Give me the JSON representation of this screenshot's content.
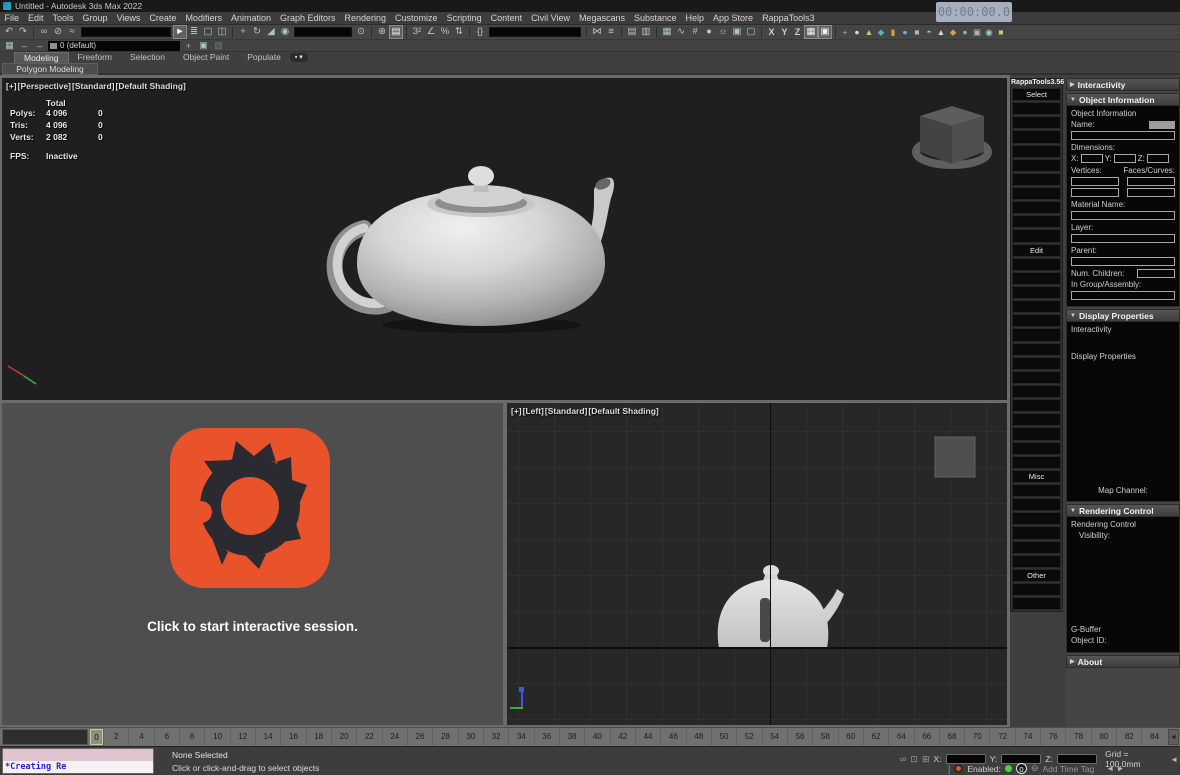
{
  "colors": {
    "corona_orange": "#e9532c",
    "logo_dark": "#2b2a30",
    "status_green": "#4ad04a"
  },
  "titlebar": {
    "title": "Untitled - Autodesk 3ds Max 2022"
  },
  "timecode": "00:00:00.0",
  "menus": [
    "File",
    "Edit",
    "Tools",
    "Group",
    "Views",
    "Create",
    "Modifiers",
    "Animation",
    "Graph Editors",
    "Rendering",
    "Customize",
    "Scripting",
    "Content",
    "Civil View",
    "Megascans",
    "Substance",
    "Help",
    "App Store",
    "RappaTools3"
  ],
  "toolbar_main": [
    {
      "n": "undo-icon",
      "g": "↶",
      "cls": "tbit i",
      "ia": "true"
    },
    {
      "n": "redo-icon",
      "g": "↷",
      "cls": "tbit i",
      "ia": "true"
    },
    {
      "n": "separator",
      "g": "",
      "cls": "tbit s",
      "ia": "false"
    },
    {
      "n": "select-and-link-icon",
      "g": "∞",
      "cls": "tbit i",
      "ia": "true"
    },
    {
      "n": "unlink-selection-icon",
      "g": "⊘",
      "cls": "tbit i",
      "ia": "true"
    },
    {
      "n": "bind-to-space-warp-icon",
      "g": "≈",
      "cls": "tbit i",
      "ia": "true"
    },
    {
      "n": "selection-filter-dropdown",
      "g": "",
      "cls": "tbit f",
      "style": "width:90px",
      "ia": "true"
    },
    {
      "n": "select-object-icon",
      "g": "►",
      "cls": "tbit i on",
      "ia": "true"
    },
    {
      "n": "select-by-name-icon",
      "g": "≣",
      "cls": "tbit i",
      "ia": "true"
    },
    {
      "n": "selection-region-icon",
      "g": "▢",
      "cls": "tbit i",
      "ia": "true"
    },
    {
      "n": "window-crossing-icon",
      "g": "◫",
      "cls": "tbit i",
      "ia": "true"
    },
    {
      "n": "separator",
      "g": "",
      "cls": "tbit s",
      "ia": "false"
    },
    {
      "n": "select-and-move-icon",
      "g": "+",
      "cls": "tbit i",
      "ia": "true"
    },
    {
      "n": "select-and-rotate-icon",
      "g": "↻",
      "cls": "tbit i",
      "ia": "true"
    },
    {
      "n": "select-and-scale-icon",
      "g": "◢",
      "cls": "tbit i",
      "ia": "true"
    },
    {
      "n": "select-and-place-icon",
      "g": "◉",
      "cls": "tbit i",
      "ia": "true"
    },
    {
      "n": "reference-coordinate-dropdown",
      "g": "",
      "cls": "tbit f",
      "style": "width:58px",
      "ia": "true"
    },
    {
      "n": "use-pivot-point-icon",
      "g": "⊙",
      "cls": "tbit i",
      "ia": "true"
    },
    {
      "n": "separator",
      "g": "",
      "cls": "tbit s",
      "ia": "false"
    },
    {
      "n": "select-and-manipulate-icon",
      "g": "⊕",
      "cls": "tbit i",
      "ia": "true"
    },
    {
      "n": "keyboard-shortcut-override-icon",
      "g": "▤",
      "cls": "tbit i on",
      "ia": "true"
    },
    {
      "n": "separator",
      "g": "",
      "cls": "tbit s",
      "ia": "false"
    },
    {
      "n": "snaps-toggle-icon",
      "g": "3²",
      "cls": "tbit i",
      "ia": "true"
    },
    {
      "n": "angle-snap-icon",
      "g": "∠",
      "cls": "tbit i",
      "ia": "true"
    },
    {
      "n": "percent-snap-icon",
      "g": "%",
      "cls": "tbit i",
      "ia": "true"
    },
    {
      "n": "spinner-snap-icon",
      "g": "⇅",
      "cls": "tbit i",
      "ia": "true"
    },
    {
      "n": "separator",
      "g": "",
      "cls": "tbit s",
      "ia": "false"
    },
    {
      "n": "edit-named-selection-sets-icon",
      "g": "{}",
      "cls": "tbit i",
      "ia": "true"
    },
    {
      "n": "named-selection-sets-dropdown",
      "g": "",
      "cls": "tbit f",
      "style": "width:92px",
      "ia": "true"
    },
    {
      "n": "separator",
      "g": "",
      "cls": "tbit s",
      "ia": "false"
    },
    {
      "n": "mirror-icon",
      "g": "⋈",
      "cls": "tbit i",
      "ia": "true"
    },
    {
      "n": "align-icon",
      "g": "≡",
      "cls": "tbit i",
      "ia": "true"
    },
    {
      "n": "separator",
      "g": "",
      "cls": "tbit s",
      "ia": "false"
    },
    {
      "n": "toggle-scene-explorer-icon",
      "g": "▤",
      "cls": "tbit i",
      "ia": "true"
    },
    {
      "n": "toggle-layer-explorer-icon",
      "g": "▥",
      "cls": "tbit i",
      "ia": "true"
    },
    {
      "n": "separator",
      "g": "",
      "cls": "tbit s",
      "ia": "false"
    },
    {
      "n": "toggle-ribbon-icon",
      "g": "▦",
      "cls": "tbit i",
      "ia": "true"
    },
    {
      "n": "curve-editor-icon",
      "g": "∿",
      "cls": "tbit i",
      "ia": "true"
    },
    {
      "n": "schematic-view-icon",
      "g": "#",
      "cls": "tbit i",
      "ia": "true"
    },
    {
      "n": "material-editor-icon",
      "g": "●",
      "cls": "tbit i",
      "ia": "true"
    },
    {
      "n": "render-setup-icon",
      "g": "☼",
      "cls": "tbit i",
      "ia": "true"
    },
    {
      "n": "rendered-frame-window-icon",
      "g": "▣",
      "cls": "tbit i",
      "ia": "true"
    },
    {
      "n": "render-production-icon",
      "g": "▢",
      "cls": "tbit i",
      "ia": "true"
    },
    {
      "n": "separator",
      "g": "",
      "cls": "tbit s",
      "ia": "false"
    },
    {
      "n": "x-constraint-button",
      "g": "X",
      "cls": "tbit t",
      "ia": "true"
    },
    {
      "n": "y-constraint-button",
      "g": "Y",
      "cls": "tbit t",
      "ia": "true"
    },
    {
      "n": "z-constraint-button",
      "g": "Z",
      "cls": "tbit t",
      "ia": "true"
    },
    {
      "n": "constraint-plane-icon",
      "g": "▦",
      "cls": "tbit i on",
      "ia": "true"
    },
    {
      "n": "constraint-plane-alt-icon",
      "g": "▣",
      "cls": "tbit i on",
      "ia": "true"
    },
    {
      "n": "separator",
      "g": "",
      "cls": "tbit s",
      "ia": "false"
    },
    {
      "n": "script-icon",
      "g": "+",
      "cls": "tbit i sc",
      "style": "color:#7cc97c",
      "ia": "true"
    },
    {
      "n": "script-icon",
      "g": "●",
      "cls": "tbit i sc",
      "style": "color:#d8d8d8",
      "ia": "true"
    },
    {
      "n": "script-icon",
      "g": "▲",
      "cls": "tbit i sc",
      "style": "color:#c9c96a",
      "ia": "true"
    },
    {
      "n": "script-icon",
      "g": "◆",
      "cls": "tbit i sc",
      "style": "color:#5fb3a1",
      "ia": "true"
    },
    {
      "n": "script-icon",
      "g": "▮",
      "cls": "tbit i sc",
      "style": "color:#cfa050",
      "ia": "true"
    },
    {
      "n": "script-icon",
      "g": "●",
      "cls": "tbit i sc",
      "style": "color:#76aede",
      "ia": "true"
    },
    {
      "n": "script-icon",
      "g": "■",
      "cls": "tbit i sc",
      "style": "color:#b5b5b5",
      "ia": "true"
    },
    {
      "n": "script-icon",
      "g": "◓",
      "cls": "tbit i sc",
      "style": "color:#8fd0c6",
      "ia": "true"
    },
    {
      "n": "script-icon",
      "g": "▲",
      "cls": "tbit i sc",
      "style": "color:#d8d8d8",
      "ia": "true"
    },
    {
      "n": "script-icon",
      "g": "◆",
      "cls": "tbit i sc",
      "style": "color:#cfa050",
      "ia": "true"
    },
    {
      "n": "script-icon",
      "g": "●",
      "cls": "tbit i sc",
      "style": "color:#7cc97c",
      "ia": "true"
    },
    {
      "n": "script-icon",
      "g": "▣",
      "cls": "tbit i sc",
      "style": "color:#b5b5b5",
      "ia": "true"
    },
    {
      "n": "script-icon",
      "g": "◉",
      "cls": "tbit i sc",
      "style": "color:#8fd0c6",
      "ia": "true"
    },
    {
      "n": "script-icon",
      "g": "■",
      "cls": "tbit i sc",
      "style": "color:#c9c96a",
      "ia": "true"
    }
  ],
  "toolbar_layer": {
    "layer_value": "0 (default)"
  },
  "ribbon": {
    "tabs": [
      {
        "label": "Modeling",
        "cls": "rtab active",
        "n": "ribbon-tab-modeling"
      },
      {
        "label": "Freeform",
        "cls": "rtab",
        "n": "ribbon-tab-freeform"
      },
      {
        "label": "Selection",
        "cls": "rtab",
        "n": "ribbon-tab-selection"
      },
      {
        "label": "Object Paint",
        "cls": "rtab",
        "n": "ribbon-tab-object-paint"
      },
      {
        "label": "Populate",
        "cls": "rtab",
        "n": "ribbon-tab-populate"
      },
      {
        "label": "▪ ▾",
        "cls": "rtab pill",
        "n": "ribbon-overflow-button"
      }
    ],
    "panel_tab": "Polygon Modeling"
  },
  "viewport_persp": {
    "label_segments": [
      "[+]",
      "[Perspective]",
      "[Standard]",
      "[Default Shading]"
    ],
    "stats": {
      "total_header": "Total",
      "rows": [
        {
          "label": "Polys:",
          "v1": "4 096",
          "v2": "0"
        },
        {
          "label": "Tris:",
          "v1": "4 096",
          "v2": "0"
        },
        {
          "label": "Verts:",
          "v1": "2 082",
          "v2": "0"
        }
      ],
      "fps_label": "FPS:",
      "fps_value": "Inactive"
    }
  },
  "viewport_left": {
    "label_segments": [
      "[+]",
      "[Left]",
      "[Standard]",
      "[Default Shading]"
    ]
  },
  "corona": {
    "message": "Click to start interactive session."
  },
  "rappatools": {
    "title": "RappaTools3.56",
    "buttons": [
      "Select",
      "",
      "",
      "",
      "",
      "",
      "",
      "",
      "",
      "",
      "",
      "Edit",
      "",
      "",
      "",
      "",
      "",
      "",
      "",
      "",
      "",
      "",
      "",
      "",
      "",
      "",
      "",
      "Misc",
      "",
      "",
      "",
      "",
      "",
      "",
      "Other",
      "",
      ""
    ]
  },
  "right_panel": {
    "interactivity": {
      "title": "Interactivity"
    },
    "object_info": {
      "title": "Object Information",
      "section": "Object Information",
      "name": "Name:",
      "dimensions": "Dimensions:",
      "x": "X:",
      "y": "Y:",
      "z": "Z:",
      "vertices": "Vertices:",
      "faces": "Faces/Curves:",
      "material": "Material Name:",
      "layer": "Layer:",
      "parent": "Parent:",
      "children": "Num. Children:",
      "group": "In Group/Assembly:"
    },
    "display_props": {
      "title": "Display Properties",
      "interactivity": "Interactivity",
      "display": "Display Properties",
      "map_channel": "Map Channel:"
    },
    "rendering": {
      "title": "Rendering Control",
      "section": "Rendering Control",
      "visibility": "Visibility:",
      "gbuffer": "G-Buffer",
      "object_id": "Object ID:"
    },
    "about": {
      "title": "About"
    }
  },
  "timeline": {
    "slider_value": "0",
    "ticks": [
      2,
      4,
      6,
      8,
      10,
      12,
      14,
      16,
      18,
      20,
      22,
      24,
      26,
      28,
      30,
      32,
      34,
      36,
      38,
      40,
      42,
      44,
      46,
      48,
      50,
      52,
      54,
      56,
      58,
      60,
      62,
      64,
      66,
      68,
      70,
      72,
      74,
      76,
      78,
      80,
      82,
      84
    ],
    "end_button": "◄"
  },
  "statusbar": {
    "listener_text": "*Creating Re",
    "selection": "None Selected",
    "prompt": "Click or click-and-drag to select objects",
    "x": "X:",
    "y": "Y:",
    "z": "Z:",
    "grid": "Grid = 100,0mm",
    "enabled": "Enabled:",
    "counter": "0",
    "add_time_tag": "Add Time Tag",
    "rewind": "◄◄",
    "step_arrows": "◄ ►"
  }
}
